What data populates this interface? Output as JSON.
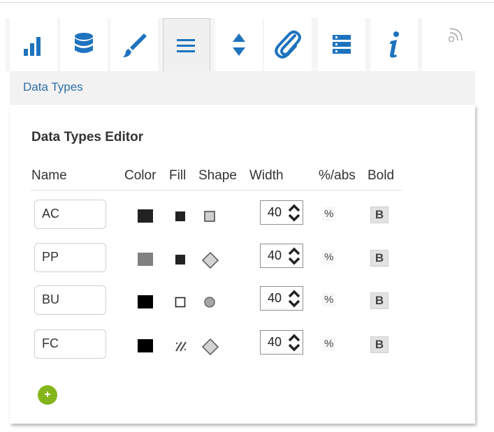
{
  "toolbar": {
    "tabs": [
      {
        "icon": "bar-chart-icon",
        "active": false
      },
      {
        "icon": "database-icon",
        "active": false
      },
      {
        "icon": "paintbrush-icon",
        "active": false
      },
      {
        "icon": "menu-lines-icon",
        "active": true
      },
      {
        "icon": "sort-arrows-icon",
        "active": false
      },
      {
        "icon": "paperclip-icon",
        "active": false
      },
      {
        "icon": "list-rows-icon",
        "active": false
      },
      {
        "icon": "info-icon",
        "active": false
      }
    ],
    "extra_icon": "rss-icon",
    "accent_color": "#1e73be"
  },
  "breadcrumb": "Data Types",
  "editor": {
    "title": "Data Types Editor",
    "headers": {
      "name": "Name",
      "color": "Color",
      "fill": "Fill",
      "shape": "Shape",
      "width": "Width",
      "pct_abs": "%/abs",
      "bold": "Bold"
    },
    "rows": [
      {
        "name": "AC",
        "color": "#222222",
        "fill": "solid",
        "shape": "square",
        "width": "40",
        "pct": "%",
        "bold": "B"
      },
      {
        "name": "PP",
        "color": "#808080",
        "fill": "solid",
        "shape": "diamond",
        "width": "40",
        "pct": "%",
        "bold": "B"
      },
      {
        "name": "BU",
        "color": "#000000",
        "fill": "empty",
        "shape": "circle",
        "width": "40",
        "pct": "%",
        "bold": "B"
      },
      {
        "name": "FC",
        "color": "#000000",
        "fill": "hatched",
        "shape": "diamond",
        "width": "40",
        "pct": "%",
        "bold": "B"
      }
    ],
    "add_button": "+",
    "add_button_color": "#84b51b"
  }
}
